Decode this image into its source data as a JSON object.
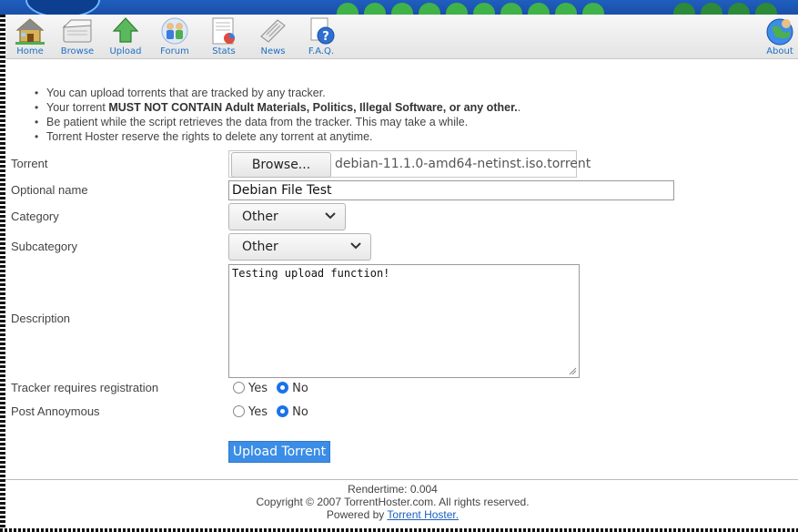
{
  "nav": {
    "items": [
      {
        "label": "Home",
        "icon": "home-icon"
      },
      {
        "label": "Browse",
        "icon": "browse-icon"
      },
      {
        "label": "Upload",
        "icon": "upload-icon"
      },
      {
        "label": "Forum",
        "icon": "forum-icon"
      },
      {
        "label": "Stats",
        "icon": "stats-icon"
      },
      {
        "label": "News",
        "icon": "news-icon"
      },
      {
        "label": "F.A.Q.",
        "icon": "faq-icon"
      }
    ],
    "about": {
      "label": "About",
      "icon": "about-icon"
    }
  },
  "notes": [
    {
      "pre": "You can upload torrents that are tracked by any tracker.",
      "bold": "",
      "post": ""
    },
    {
      "pre": "Your torrent ",
      "bold": "MUST NOT CONTAIN Adult Materials, Politics, Illegal Software, or any other.",
      "post": "."
    },
    {
      "pre": "Be patient while the script retrieves the data from the tracker. This may take a while.",
      "bold": "",
      "post": ""
    },
    {
      "pre": "Torrent Hoster reserve the rights to delete any torrent at anytime.",
      "bold": "",
      "post": ""
    }
  ],
  "form": {
    "torrent_label": "Torrent",
    "browse_label": "Browse...",
    "file_name": "debian-11.1.0-amd64-netinst.iso.torrent",
    "name_label": "Optional name",
    "name_value": "Debian File Test",
    "category_label": "Category",
    "category_value": "Other",
    "subcategory_label": "Subcategory",
    "subcategory_value": "Other",
    "description_label": "Description",
    "description_value": "Testing upload function!",
    "tracker_label": "Tracker requires registration",
    "tracker_yes": "Yes",
    "tracker_no": "No",
    "tracker_selected": "No",
    "anon_label": "Post Annoymous",
    "anon_yes": "Yes",
    "anon_no": "No",
    "anon_selected": "No",
    "submit_label": "Upload Torrent"
  },
  "footer": {
    "rendertime": "Rendertime: 0.004",
    "copyright": "Copyright © 2007 TorrentHoster.com. All rights reserved.",
    "powered_prefix": "Powered by ",
    "powered_link": "Torrent Hoster."
  },
  "colors": {
    "accent": "#3b8de6",
    "nav_text": "#1e6fc0",
    "radio_on": "#1a73e8"
  }
}
